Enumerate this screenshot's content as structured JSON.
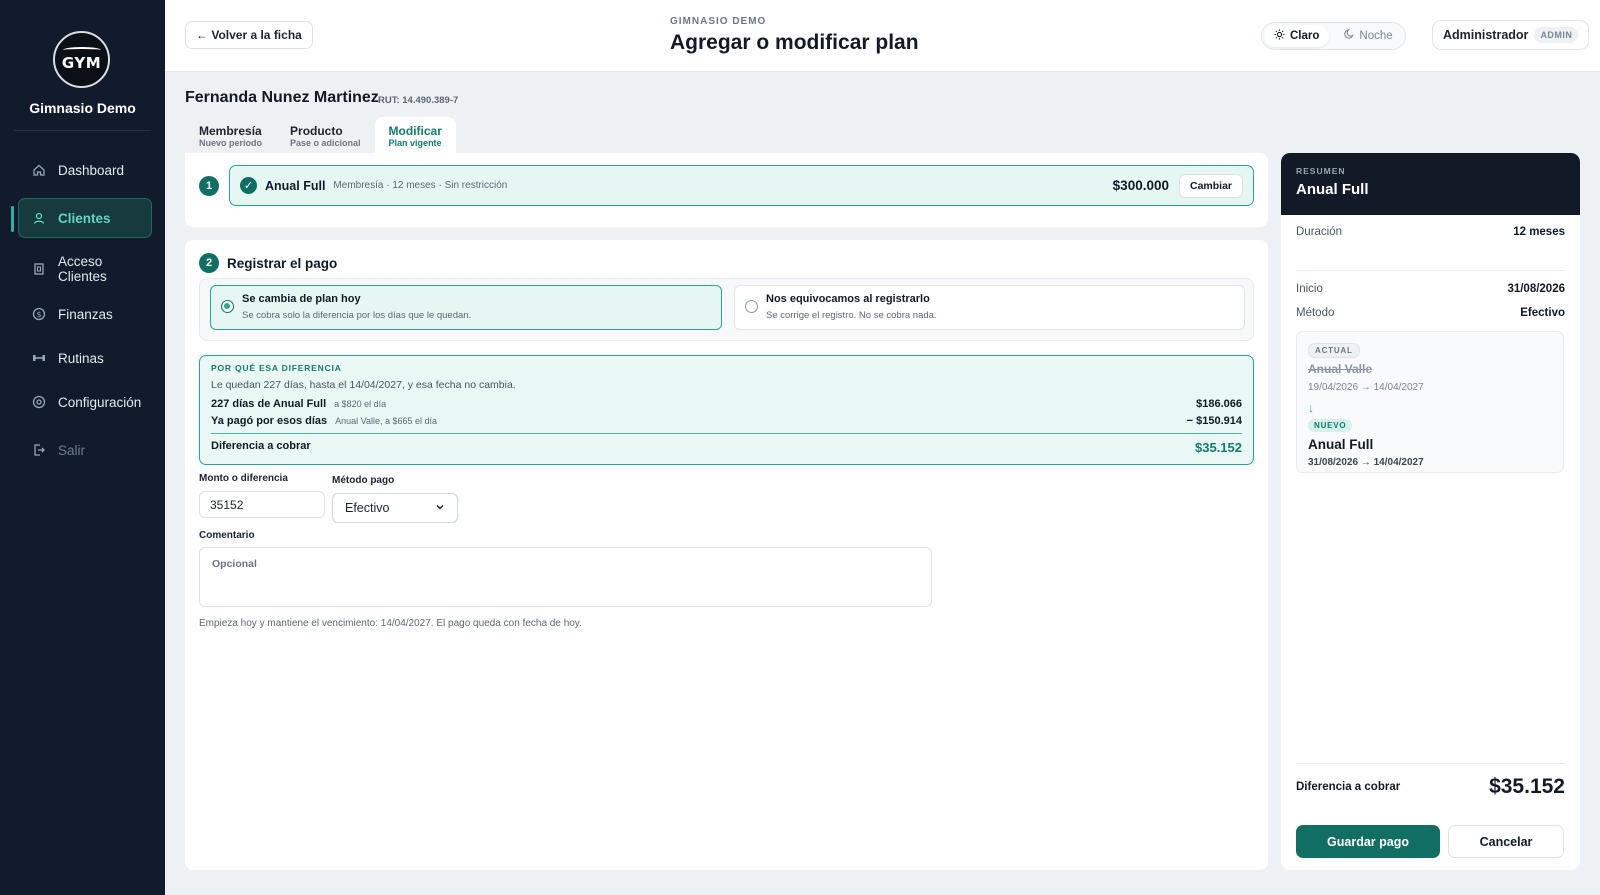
{
  "sidebar": {
    "logo_text": "GYM",
    "gym_name": "Gimnasio Demo",
    "items": [
      {
        "label": "Dashboard",
        "icon": "home-icon"
      },
      {
        "label": "Clientes",
        "icon": "user-icon",
        "active": true
      },
      {
        "label": "Acceso Clientes",
        "icon": "door-icon"
      },
      {
        "label": "Finanzas",
        "icon": "dollar-icon"
      },
      {
        "label": "Rutinas",
        "icon": "dumbbell-icon"
      },
      {
        "label": "Configuración",
        "icon": "gear-icon"
      },
      {
        "label": "Salir",
        "icon": "logout-icon"
      }
    ]
  },
  "header": {
    "back_label": "← Volver a la ficha",
    "eyebrow": "GIMNASIO DEMO",
    "title": "Agregar o modificar plan",
    "theme_light": "Claro",
    "theme_dark": "Noche",
    "user_name": "Administrador",
    "user_role": "ADMIN"
  },
  "client": {
    "name": "Fernanda Nunez Martinez",
    "rut": "RUT: 14.490.389-7"
  },
  "tabs": [
    {
      "label": "Membresía",
      "sub": "Nuevo periodo"
    },
    {
      "label": "Producto",
      "sub": "Pase o adicional"
    },
    {
      "label": "Modificar",
      "sub": "Plan vigente",
      "active": true
    }
  ],
  "step1": {
    "num": "1",
    "plan_name": "Anual Full",
    "plan_meta": "Membresía · 12 meses · Sin restricción",
    "price": "$300.000",
    "change_label": "Cambiar"
  },
  "step2": {
    "num": "2",
    "title": "Registrar el pago",
    "option_a_title": "Se cambia de plan hoy",
    "option_a_sub": "Se cobra solo la diferencia por los días que le quedan.",
    "option_b_title": "Nos equivocamos al registrarlo",
    "option_b_sub": "Se corrige el registro. No se cobra nada.",
    "why": {
      "eyebrow": "POR QUÉ ESA DIFERENCIA",
      "text": "Le quedan 227 días, hasta el 14/04/2027, y esa fecha no cambia.",
      "row1_label": "227 días de Anual Full",
      "row1_small": "a $820 el día",
      "row1_amount": "$186.066",
      "row2_label": "Ya pagó por esos días",
      "row2_small": "Anual Valle, a $665 el día",
      "row2_amount": "− $150.914",
      "total_label": "Diferencia a cobrar",
      "total_amount": "$35.152"
    },
    "amount_label": "Monto o diferencia",
    "amount_value": "35152",
    "method_label": "Método pago",
    "method_value": "Efectivo",
    "comment_label": "Comentario",
    "comment_placeholder": "Opcional",
    "note": "Empieza hoy y mantiene el vencimiento: 14/04/2027. El pago queda con fecha de hoy."
  },
  "summary": {
    "eyebrow": "RESUMEN",
    "title": "Anual Full",
    "duration_label": "Duración",
    "duration_value": "12 meses",
    "start_label": "Inicio",
    "start_value": "31/08/2026",
    "method_label": "Método",
    "method_value": "Efectivo",
    "actual_badge": "ACTUAL",
    "old_plan": "Anual Valle",
    "old_dates": "19/04/2026 → 14/04/2027",
    "arrow": "↓",
    "new_badge": "NUEVO",
    "new_plan": "Anual Full",
    "new_dates": "31/08/2026 → 14/04/2027",
    "total_label": "Diferencia a cobrar",
    "total_value": "$35.152",
    "save_label": "Guardar pago",
    "cancel_label": "Cancelar"
  },
  "colors": {
    "sidebar_bg": "#111b2b",
    "accent": "#116e62",
    "accent_light": "#e6f7f3",
    "accent_border": "#2aa592"
  }
}
